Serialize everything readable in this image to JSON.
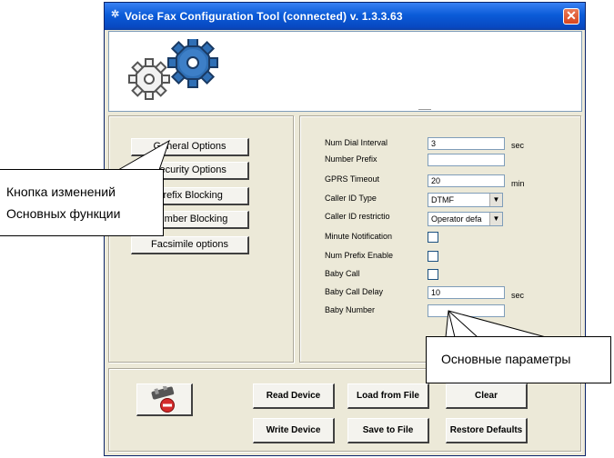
{
  "window": {
    "title": "Voice Fax Configuration Tool (connected)  v. 1.3.3.63",
    "close_glyph": "✕"
  },
  "nav": {
    "buttons": [
      "General Options",
      "Security Options",
      "Prefix Blocking",
      "Number Blocking",
      "Facsimile options"
    ]
  },
  "settings": {
    "num_dial_interval": {
      "label": "Num Dial Interval",
      "value": "3",
      "unit": "sec"
    },
    "number_prefix": {
      "label": "Number Prefix",
      "value": ""
    },
    "gprs_timeout": {
      "label": "GPRS Timeout",
      "value": "20",
      "unit": "min"
    },
    "caller_id_type": {
      "label": "Caller ID Type",
      "value": "DTMF"
    },
    "caller_id_restriction": {
      "label": "Caller ID restrictio",
      "value": "Operator defa"
    },
    "minute_notification": {
      "label": "Minute Notification",
      "checked": false
    },
    "num_prefix_enable": {
      "label": "Num Prefix Enable",
      "checked": false
    },
    "baby_call": {
      "label": "Baby Call",
      "checked": false
    },
    "baby_call_delay": {
      "label": "Baby Call Delay",
      "value": "10",
      "unit": "sec"
    },
    "baby_number": {
      "label": "Baby Number",
      "value": ""
    }
  },
  "actions": {
    "read_device": "Read Device",
    "load_from_file": "Load from File",
    "clear": "Clear",
    "write_device": "Write Device",
    "save_to_file": "Save to File",
    "restore_defaults": "Restore Defaults"
  },
  "callouts": {
    "left_line1": "Кнопка изменений",
    "left_line2": "Основных функции",
    "right": "Основные параметры"
  },
  "icons": {
    "title": "app-icon",
    "banner": "gears-logo",
    "device": "disconnect-device-icon"
  }
}
